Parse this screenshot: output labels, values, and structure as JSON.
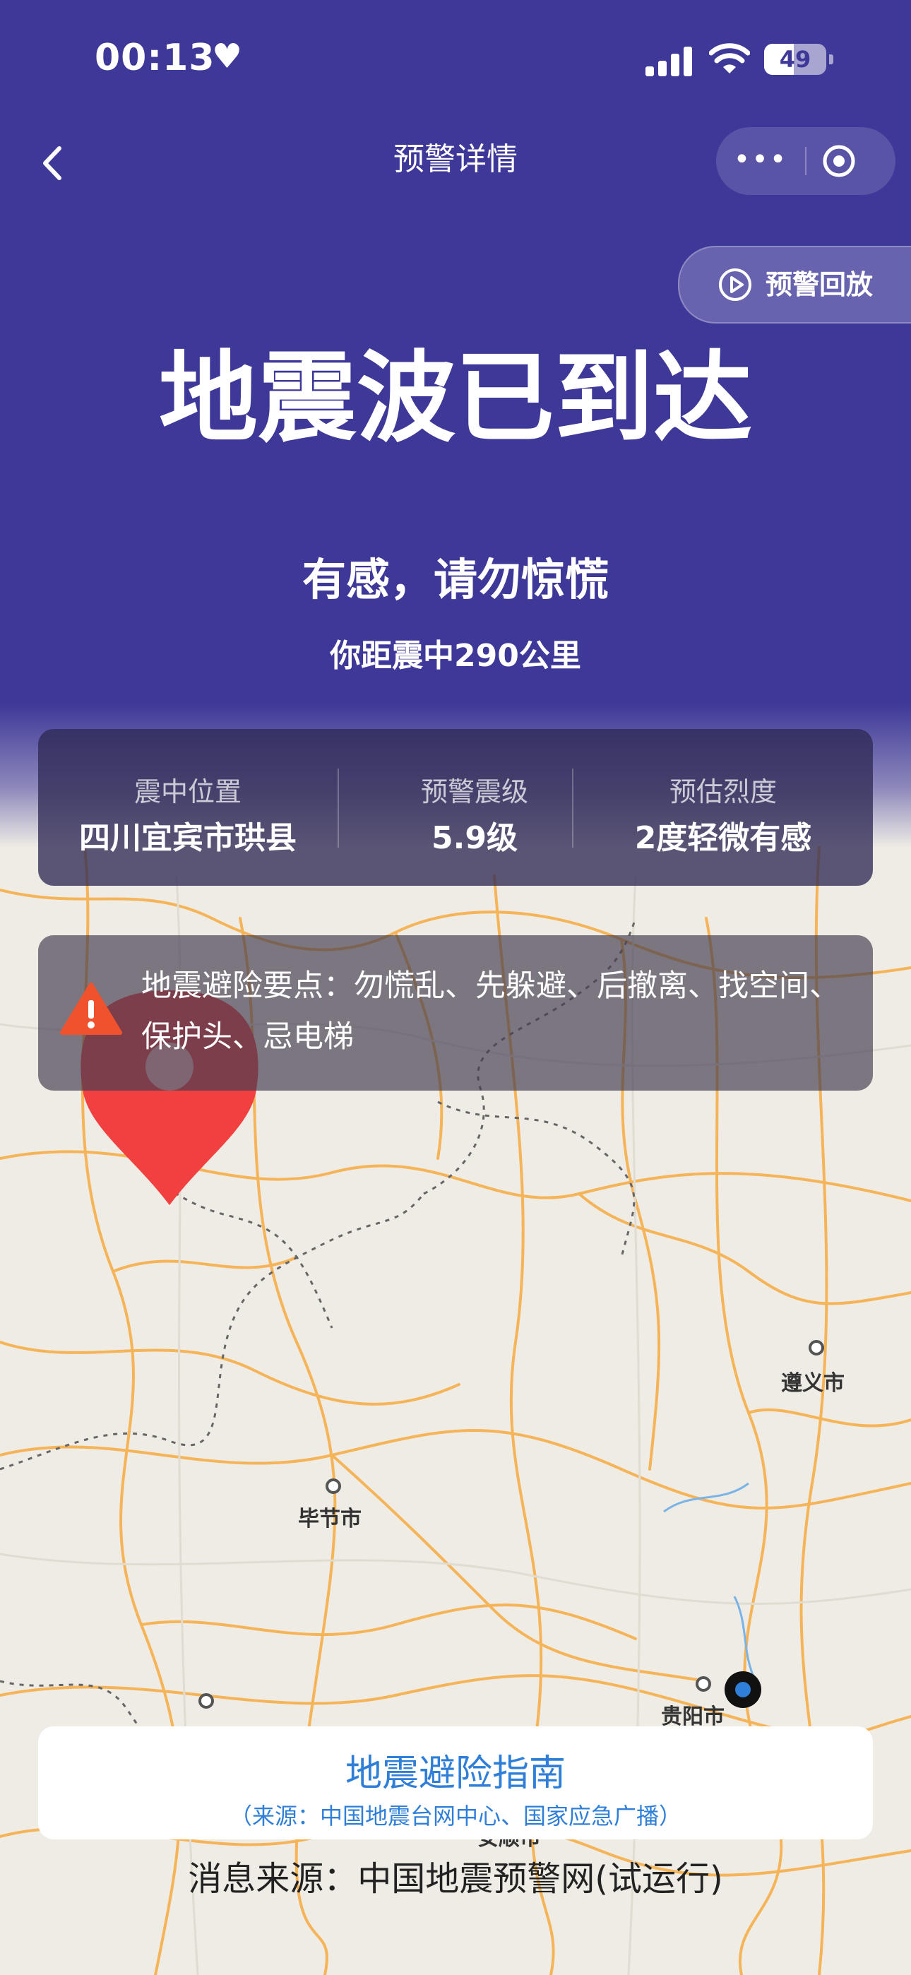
{
  "status_bar": {
    "time": "00:13",
    "battery": "49"
  },
  "nav": {
    "title": "预警详情",
    "more": "•••"
  },
  "replay_button": {
    "label": "预警回放"
  },
  "headline": "地震波已到达",
  "subhead": "有感，请勿惊慌",
  "distance": "你距震中290公里",
  "info": {
    "epicenter_label": "震中位置",
    "epicenter_value": "四川宜宾市珙县",
    "magnitude_label": "预警震级",
    "magnitude_value": "5.9级",
    "intensity_label": "预估烈度",
    "intensity_value": "2度轻微有感"
  },
  "tips": {
    "text": "地震避险要点：勿慌乱、先躲避、后撤离、找空间、保护头、忌电梯"
  },
  "map": {
    "cities": [
      "遵义市",
      "毕节市",
      "贵阳市",
      "安顺市"
    ],
    "colors": {
      "road": "#f5b458",
      "border": "#666666",
      "pin": "#f24040",
      "user": "#2f7fd9"
    }
  },
  "guide": {
    "title": "地震避险指南",
    "source": "（来源：中国地震台网中心、国家应急广播）"
  },
  "source_line": "消息来源：中国地震预警网(试运行)"
}
